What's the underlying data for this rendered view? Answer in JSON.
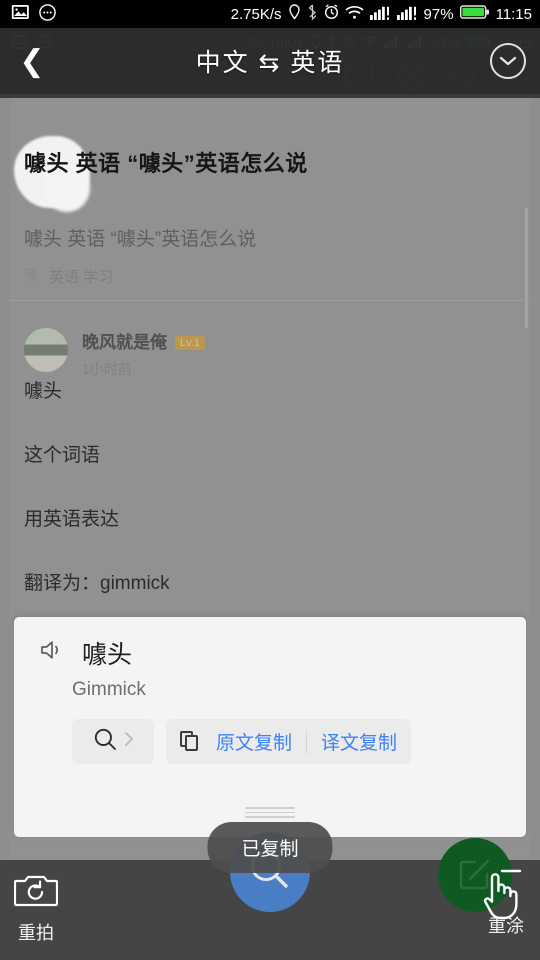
{
  "status_bar": {
    "net_speed": "2.75K/s",
    "battery_percent": "97%",
    "clock": "11:15",
    "icons": [
      "image-icon",
      "chat-icon",
      "location-icon",
      "bluetooth-icon",
      "alarm-icon",
      "wifi-icon",
      "signal-1-icon",
      "signal-2-icon",
      "battery-icon"
    ]
  },
  "underlying_app": {
    "status_speed": "29.19K/s",
    "battery_percent": "97%",
    "clock": "11:15",
    "question_title": "噱头 英语 “噱头”英语怎么说",
    "question_sub": "噱头 英语 “噱头”英语怎么说",
    "tags": "英语 学习",
    "tag_icon": "tag-icon",
    "poster_name": "晚风就是俺",
    "poster_level": "Lv.1",
    "poster_time": "1小时前",
    "answer_lines": [
      "噱头",
      "这个词语",
      "用英语表达",
      "翻译为：gimmick"
    ],
    "nav_icons": [
      "comment-icon",
      "aperture-icon",
      "star-icon",
      "more-icon"
    ]
  },
  "translate_header": {
    "back_icon": "back-chevron-icon",
    "title": "中文 ⇆ 英语",
    "collapse_icon": "chevron-down-circle-icon"
  },
  "result_card": {
    "speaker_icon": "speaker-icon",
    "source_word": "噱头",
    "translated_word": "Gimmick",
    "search_icon": "search-icon",
    "search_chevron_icon": "chevron-right-icon",
    "copy_icon": "copy-icon",
    "copy_source_label": "原文复制",
    "copy_target_label": "译文复制",
    "drag_handle_icon": "drag-handle-icon"
  },
  "toast": {
    "message": "已复制"
  },
  "bottom_bar": {
    "retake_label": "重拍",
    "retake_icon": "camera-retake-icon",
    "search_icon": "search-icon",
    "repaint_label": "重涂",
    "repaint_icon": "edit-square-icon",
    "cursor_icon": "pointing-hand-icon"
  },
  "colors": {
    "accent_blue": "#3e82f7",
    "search_blue": "#4a7ec4",
    "repaint_green": "#0f5a23",
    "level_badge": "#c79a3a",
    "battery_green": "#3ddc3d"
  }
}
